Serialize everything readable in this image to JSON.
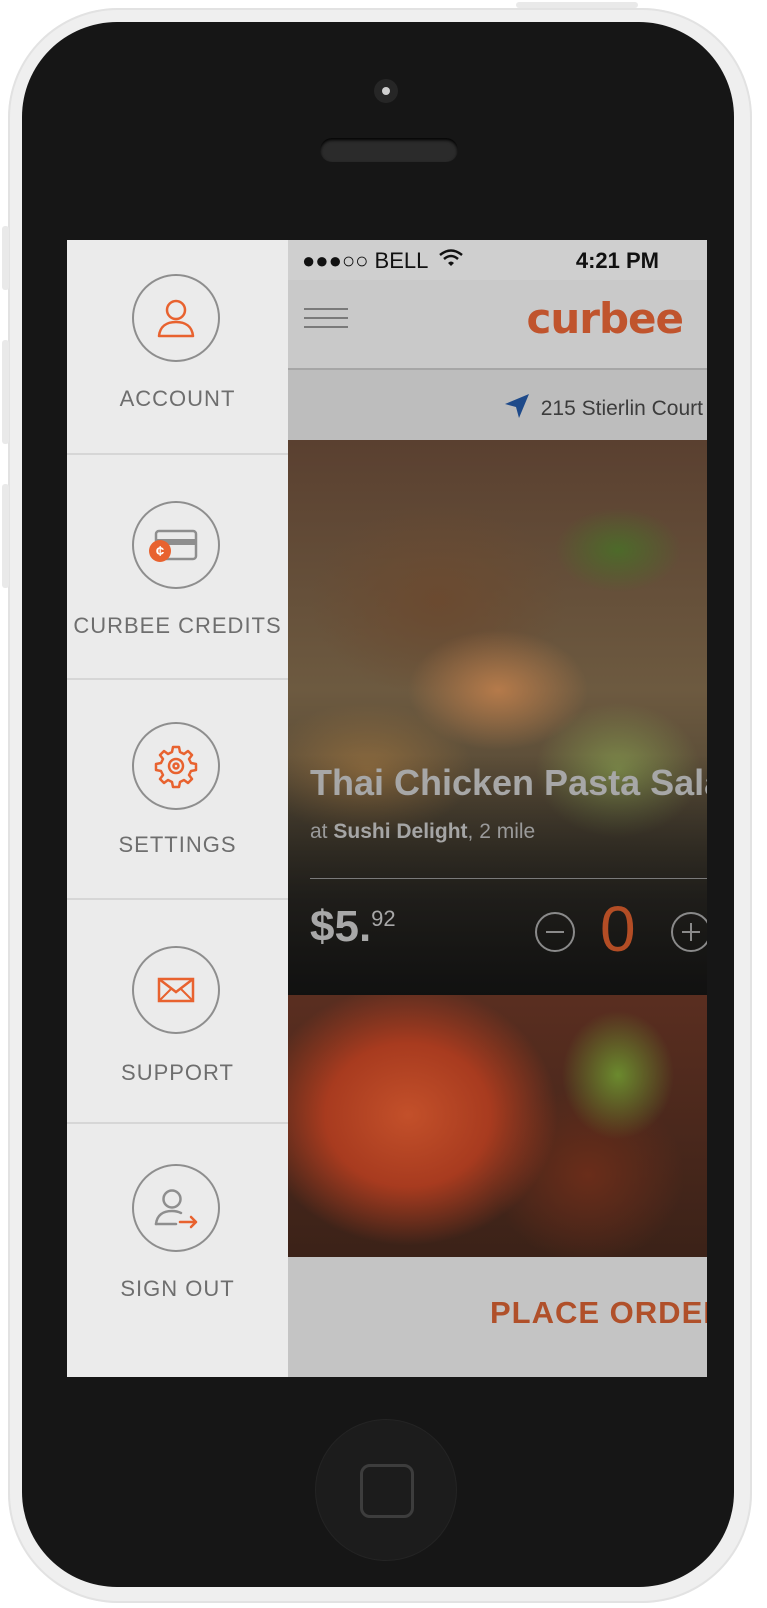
{
  "status_bar": {
    "carrier": "●●●○○ BELL",
    "time": "4:21 PM"
  },
  "header": {
    "logo": "curbee"
  },
  "location": {
    "address": "215 Stierlin Court"
  },
  "menu": {
    "items": [
      {
        "label": "ACCOUNT",
        "icon": "user-icon"
      },
      {
        "label": "CURBEE CREDITS",
        "icon": "credit-card-icon"
      },
      {
        "label": "SETTINGS",
        "icon": "gear-icon"
      },
      {
        "label": "SUPPORT",
        "icon": "envelope-icon"
      },
      {
        "label": "SIGN OUT",
        "icon": "sign-out-icon"
      }
    ]
  },
  "dish": {
    "title": "Thai Chicken Pasta Sala",
    "at": "at",
    "restaurant": "Sushi  Delight",
    "distance": ", 2 mile",
    "price_main": "$5.",
    "price_cents": "92",
    "quantity": "0"
  },
  "order": {
    "place_order_label": "PLACE ORDEF"
  },
  "colors": {
    "accent": "#e8622f",
    "ring": "#8e8e8e",
    "drawer_bg": "#ebebeb"
  }
}
